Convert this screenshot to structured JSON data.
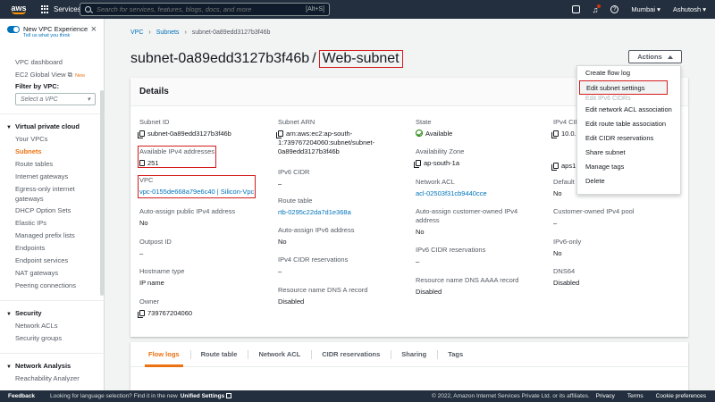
{
  "topbar": {
    "logo": "aws",
    "services": "Services",
    "search_placeholder": "Search for services, features, blogs, docs, and more",
    "search_shortcut": "[Alt+S]",
    "region": "Mumbai",
    "user": "Ashutosh"
  },
  "sidebar": {
    "vpc_experience_title": "New VPC Experience",
    "vpc_experience_sub": "Tell us what you think",
    "dashboard": "VPC dashboard",
    "ec2_global": "EC2 Global View",
    "new_badge": "New",
    "filter_label": "Filter by VPC:",
    "filter_placeholder": "Select a VPC",
    "section_vpc": "Virtual private cloud",
    "vpc_items": [
      "Your VPCs",
      "Subnets",
      "Route tables",
      "Internet gateways",
      "Egress-only internet gateways",
      "DHCP Option Sets",
      "Elastic IPs",
      "Managed prefix lists",
      "Endpoints",
      "Endpoint services",
      "NAT gateways",
      "Peering connections"
    ],
    "section_security": "Security",
    "security_items": [
      "Network ACLs",
      "Security groups"
    ],
    "section_network": "Network Analysis",
    "network_items": [
      "Reachability Analyzer"
    ]
  },
  "breadcrumb": {
    "vpc": "VPC",
    "subnets": "Subnets",
    "current": "subnet-0a89edd3127b3f46b"
  },
  "page": {
    "subnet_id": "subnet-0a89edd3127b3f46b",
    "separator": "/",
    "subnet_name": "Web-subnet",
    "actions_label": "Actions"
  },
  "details": {
    "heading": "Details",
    "subnet_id_label": "Subnet ID",
    "subnet_id_value": "subnet-0a89edd3127b3f46b",
    "ipv4_avail_label": "Available IPv4 addresses",
    "ipv4_avail_value": "251",
    "vpc_label": "VPC",
    "vpc_value": "vpc-0155de668a79e6c40 | Silicon-Vpc",
    "auto_ipv4_label": "Auto-assign public IPv4 address",
    "auto_ipv4_value": "No",
    "outpost_label": "Outpost ID",
    "outpost_value": "–",
    "hostname_label": "Hostname type",
    "hostname_value": "IP name",
    "owner_label": "Owner",
    "owner_value": "739767204060",
    "arn_label": "Subnet ARN",
    "arn_value_1": "arn:aws:ec2:ap-south-",
    "arn_value_2": "1:739767204060:subnet/subnet-",
    "arn_value_3": "0a89edd3127b3f46b",
    "ipv6_cidr_label": "IPv6 CIDR",
    "ipv6_cidr_value": "–",
    "route_table_label": "Route table",
    "route_table_value": "rtb-0295c22da7d1e368a",
    "auto_ipv6_label": "Auto-assign IPv6 address",
    "auto_ipv6_value": "No",
    "ipv4_res_label": "IPv4 CIDR reservations",
    "ipv4_res_value": "–",
    "dns_a_label": "Resource name DNS A record",
    "dns_a_value": "Disabled",
    "state_label": "State",
    "state_value": "Available",
    "az_label": "Availability Zone",
    "az_value": "ap-south-1a",
    "nacl_label": "Network ACL",
    "nacl_value": "acl-02503f31cb9440cce",
    "auto_coip_label_1": "Auto-assign customer-owned IPv4",
    "auto_coip_label_2": "address",
    "auto_coip_value": "No",
    "ipv6_res_label": "IPv6 CIDR reservations",
    "ipv6_res_value": "–",
    "dns_aaaa_label": "Resource name DNS AAAA record",
    "dns_aaaa_value": "Disabled",
    "ipv4_cidr_label": "IPv4 CID",
    "ipv4_cidr_value": "10.0.",
    "aps_value": "aps1",
    "default_label": "Default",
    "default_value": "No",
    "coip_pool_label": "Customer-owned IPv4 pool",
    "coip_pool_value": "–",
    "ipv6_only_label": "IPv6-only",
    "ipv6_only_value": "No",
    "dns64_label": "DNS64",
    "dns64_value": "Disabled"
  },
  "actions_menu": {
    "items": [
      "Create flow log",
      "Edit subnet settings",
      "Edit IPv6 CIDRs",
      "Edit network ACL association",
      "Edit route table association",
      "Edit CIDR reservations",
      "Share subnet",
      "Manage tags",
      "Delete"
    ]
  },
  "tabs": [
    "Flow logs",
    "Route table",
    "Network ACL",
    "CIDR reservations",
    "Sharing",
    "Tags"
  ],
  "footer": {
    "feedback": "Feedback",
    "language_text": "Looking for language selection? Find it in the new",
    "unified": "Unified Settings",
    "copyright": "© 2022, Amazon Internet Services Private Ltd. or its affiliates.",
    "privacy": "Privacy",
    "terms": "Terms",
    "cookies": "Cookie preferences"
  }
}
